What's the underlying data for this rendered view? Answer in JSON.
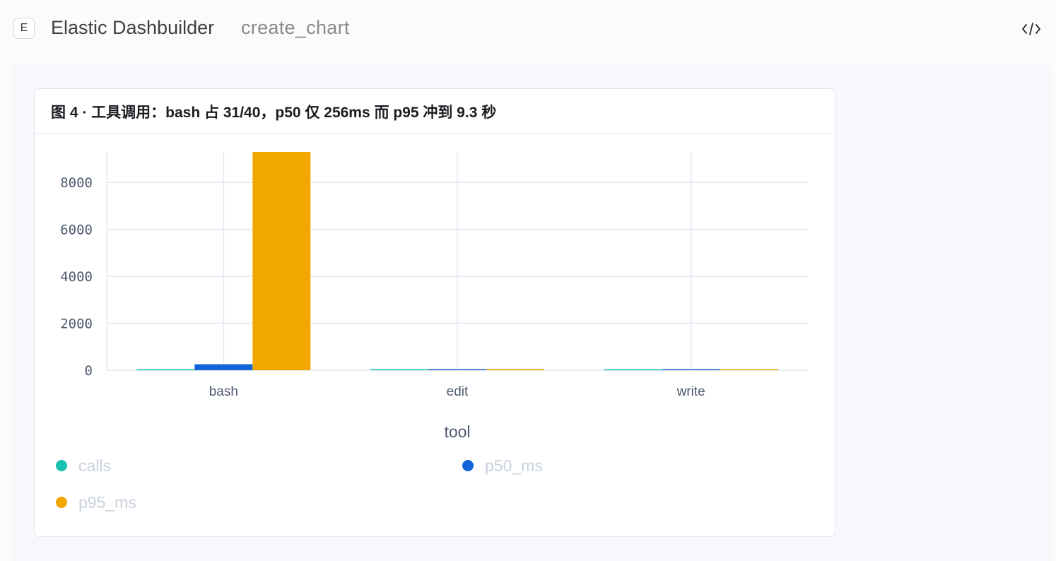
{
  "app": {
    "badge": "E",
    "title": "Elastic Dashbuilder",
    "subtitle": "create_chart",
    "code_icon": "code-icon"
  },
  "panel": {
    "title": "图 4 · 工具调用：bash 占 31/40，p50 仅 256ms 而 p95 冲到 9.3 秒"
  },
  "colors": {
    "calls": "#1bbfae",
    "p50_ms": "#1265d9",
    "p95_ms": "#f2a600",
    "grid": "#e3e8f2",
    "axis_text": "#4e5a6e",
    "legend_text": "#c9d1dd"
  },
  "chart_data": {
    "type": "bar",
    "xlabel": "tool",
    "ylabel": "",
    "categories": [
      "bash",
      "edit",
      "write"
    ],
    "ylim": [
      0,
      9300
    ],
    "yticks": [
      0,
      2000,
      4000,
      6000,
      8000
    ],
    "grid": true,
    "legend_position": "bottom",
    "series": [
      {
        "name": "calls",
        "values": [
          31,
          6,
          3
        ]
      },
      {
        "name": "p50_ms",
        "values": [
          256,
          40,
          35
        ]
      },
      {
        "name": "p95_ms",
        "values": [
          9300,
          50,
          45
        ]
      }
    ]
  }
}
